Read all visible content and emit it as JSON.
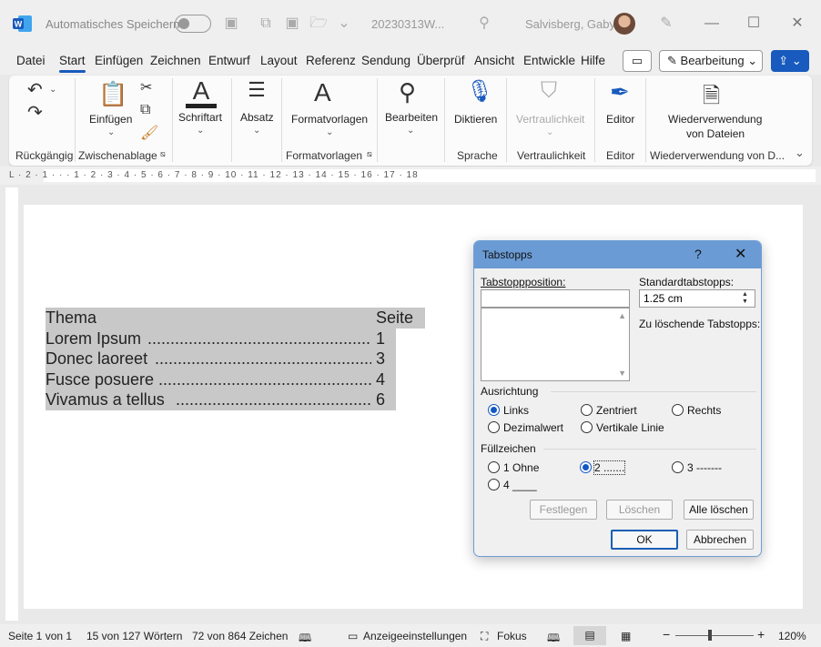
{
  "titlebar": {
    "autosave_label": "Automatisches Speichern",
    "document_name": "20230313W...",
    "user_name": "Salvisberg, Gaby"
  },
  "menu": {
    "tabs": [
      "Datei",
      "Start",
      "Einfügen",
      "Zeichnen",
      "Entwurf",
      "Layout",
      "Referenz",
      "Sendung",
      "Überprüf",
      "Ansicht",
      "Entwickle",
      "Hilfe"
    ],
    "active_tab": "Start",
    "editing_label": "Bearbeitung"
  },
  "ribbon": {
    "paste": "Einfügen",
    "font": "Schriftart",
    "paragraph": "Absatz",
    "styles": "Formatvorlagen",
    "edit": "Bearbeiten",
    "dictate": "Diktieren",
    "sensitivity": "Vertraulichkeit",
    "editor": "Editor",
    "reuse": "Wiederverwendung",
    "reuse2": "von Dateien",
    "groups": {
      "undo": "Rückgängig",
      "clipboard": "Zwischenablage",
      "styles": "Formatvorlagen",
      "voice": "Sprache",
      "sensitivity": "Vertraulichkeit",
      "editor": "Editor",
      "reuse": "Wiederverwendung von D..."
    }
  },
  "ruler": {
    "marks": "L · 2 · 1 · · · 1 · 2 · 3 · 4 · 5 · 6 · 7 · 8 · 9 · 10 · 11 · 12 · 13 · 14 · 15 · 16 · 17 · 18"
  },
  "toc": {
    "header_title": "Thema",
    "header_page": "Seite",
    "rows": [
      {
        "title": "Lorem Ipsum",
        "page": "1"
      },
      {
        "title": "Donec laoreet",
        "page": "3"
      },
      {
        "title": "Fusce posuere",
        "page": "4"
      },
      {
        "title": "Vivamus a tellus",
        "page": "6"
      }
    ]
  },
  "dialog": {
    "title": "Tabstopps",
    "help": "?",
    "position_label": "Tabstoppposition:",
    "position_value": "",
    "default_label": "Standardtabstopps:",
    "default_value": "1.25 cm",
    "clear_label": "Zu löschende Tabstopps:",
    "alignment_label": "Ausrichtung",
    "align_left": "Links",
    "align_center": "Zentriert",
    "align_right": "Rechts",
    "align_decimal": "Dezimalwert",
    "align_bar": "Vertikale Linie",
    "leader_label": "Füllzeichen",
    "leader_1": "1 Ohne",
    "leader_2": "2 .......",
    "leader_3": "3 -------",
    "leader_4": "4 ____",
    "btn_set": "Festlegen",
    "btn_clear": "Löschen",
    "btn_clear_all": "Alle löschen",
    "btn_ok": "OK",
    "btn_cancel": "Abbrechen",
    "selected_alignment": "Links",
    "selected_leader": "2 ......."
  },
  "statusbar": {
    "page": "Seite 1 von 1",
    "words": "15 von 127 Wörtern",
    "chars": "72 von 864 Zeichen",
    "display": "Anzeigeeinstellungen",
    "focus": "Fokus",
    "zoom": "120%"
  },
  "colors": {
    "accent": "#185abd",
    "dialog_title": "#6a9bd4",
    "selection": "#c8c8c8"
  }
}
